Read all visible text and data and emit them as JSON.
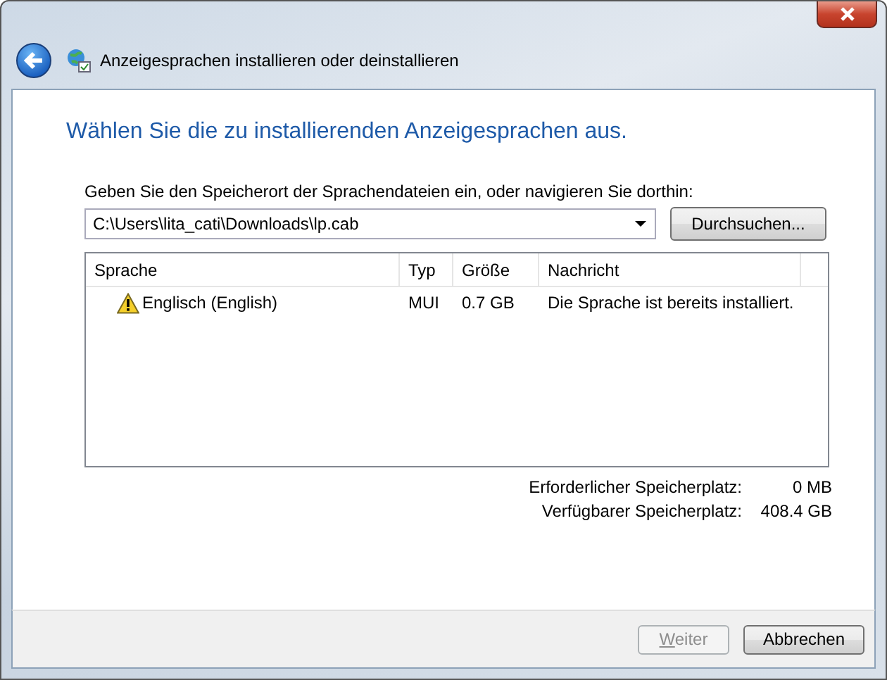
{
  "window": {
    "title": "Anzeigesprachen installieren oder deinstallieren"
  },
  "heading": "Wählen Sie die zu installierenden Anzeigesprachen aus.",
  "location": {
    "label": "Geben Sie den Speicherort der Sprachendateien ein, oder navigieren Sie dorthin:",
    "value": "C:\\Users\\lita_cati\\Downloads\\lp.cab",
    "browse_button": "Durchsuchen..."
  },
  "table": {
    "columns": [
      "Sprache",
      "Typ",
      "Größe",
      "Nachricht"
    ],
    "rows": [
      {
        "kind": "warning",
        "selected": false,
        "cells": [
          "Englisch (English)",
          "MUI",
          "0.7 GB",
          "Die Sprache ist bereits installiert."
        ]
      }
    ]
  },
  "storage": [
    {
      "label": "Erforderlicher Speicherplatz:",
      "value": "0 MB"
    },
    {
      "label": "Verfügbarer Speicherplatz:",
      "value": "408.4 GB"
    }
  ],
  "buttons": [
    {
      "label": "Weiter",
      "disabled": true
    },
    {
      "label": "Abbrechen",
      "disabled": false
    }
  ]
}
